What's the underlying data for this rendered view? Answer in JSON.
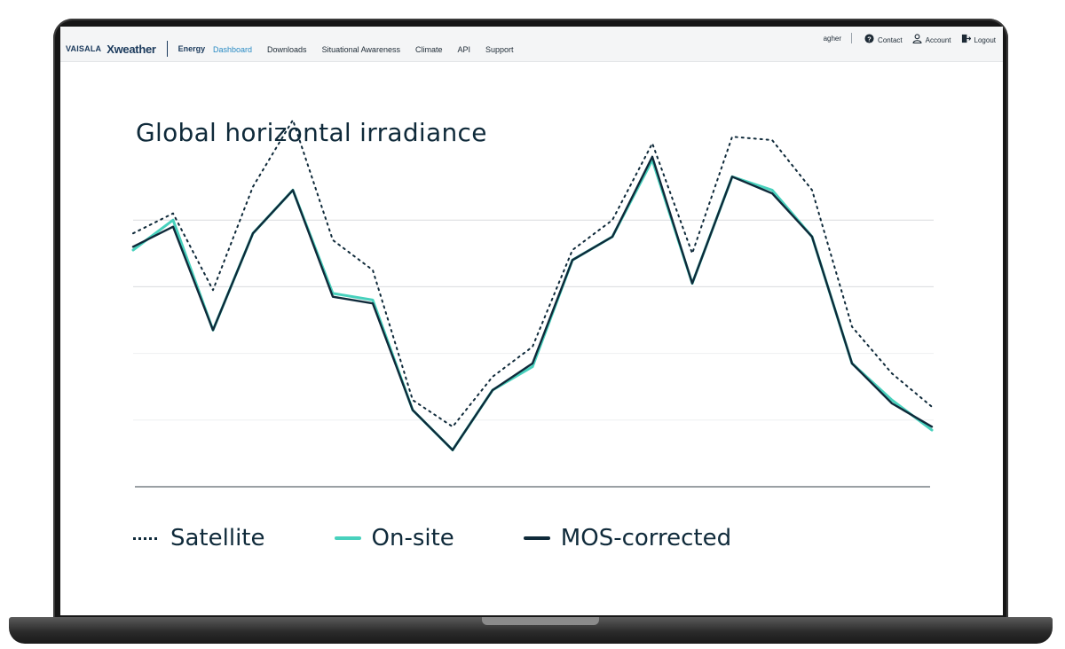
{
  "brand": {
    "company": "VAISALA",
    "product": "Xweather",
    "section": "Energy"
  },
  "nav": {
    "items": [
      {
        "label": "Dashboard",
        "active": true
      },
      {
        "label": "Downloads",
        "active": false
      },
      {
        "label": "Situational Awareness",
        "active": false
      },
      {
        "label": "Climate",
        "active": false
      },
      {
        "label": "API",
        "active": false
      },
      {
        "label": "Support",
        "active": false
      }
    ]
  },
  "user": {
    "name": "agher",
    "contact_label": "Contact",
    "account_label": "Account",
    "logout_label": "Logout"
  },
  "icons": {
    "contact": "help-circle-icon",
    "account": "user-icon",
    "logout": "logout-icon"
  },
  "colors": {
    "accent_nav": "#2a8bc4",
    "satellite": "#0f2a3a",
    "onsite": "#48d1bd",
    "mos": "#0f2a3a"
  },
  "chart_data": {
    "type": "line",
    "title": "Global horizontal irradiance",
    "xlabel": "",
    "ylabel": "",
    "grid": true,
    "ylim": [
      0,
      100
    ],
    "legend_placement": "bottom",
    "x": [
      0,
      1,
      2,
      3,
      4,
      5,
      6,
      7,
      8,
      9,
      10,
      11,
      12,
      13,
      14,
      15,
      16,
      17,
      18,
      19,
      20
    ],
    "series": [
      {
        "name": "Satellite",
        "style": "dotted",
        "values": [
          76,
          82,
          59,
          90,
          110,
          74,
          65,
          26,
          18,
          33,
          42,
          71,
          80,
          103,
          70,
          105,
          104,
          89,
          48,
          34,
          24
        ]
      },
      {
        "name": "On-site",
        "style": "solid",
        "values": [
          71,
          80,
          47,
          76,
          89,
          58,
          56,
          23,
          11,
          29,
          36,
          68,
          75,
          98,
          61,
          93,
          89,
          75,
          37,
          26,
          17
        ]
      },
      {
        "name": "MOS-corrected",
        "style": "solid-bold",
        "values": [
          72,
          78,
          47,
          76,
          89,
          57,
          55,
          23,
          11,
          29,
          37,
          68,
          75,
          99,
          61,
          93,
          88,
          75,
          37,
          25,
          18
        ]
      }
    ]
  }
}
